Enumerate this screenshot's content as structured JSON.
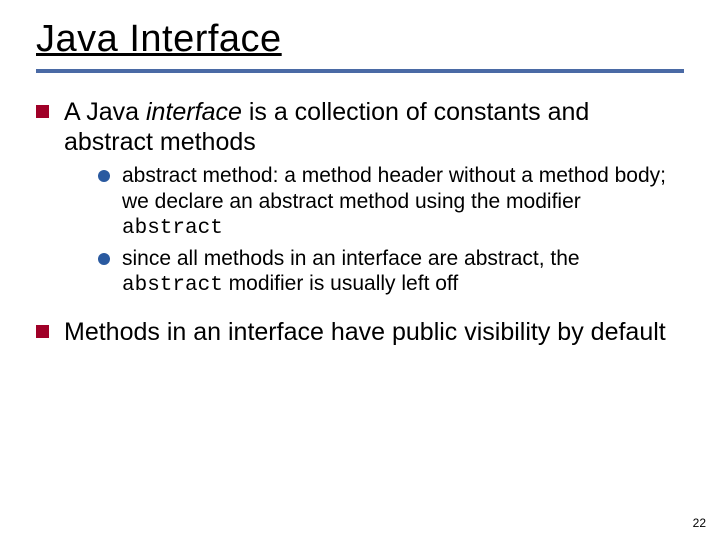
{
  "title": "Java Interface",
  "bullets": {
    "b1": {
      "pre": "A Java ",
      "em": "interface",
      "post": " is a collection of constants and abstract methods"
    },
    "sub1": {
      "pre": "abstract method: a method header without a method body; we declare an abstract method using the modifier ",
      "code": "abstract"
    },
    "sub2": {
      "pre": "since all methods in an interface are abstract, the ",
      "code": "abstract",
      "post": " modifier is usually left off"
    },
    "b2": "Methods in an interface have public visibility by default"
  },
  "page": "22"
}
